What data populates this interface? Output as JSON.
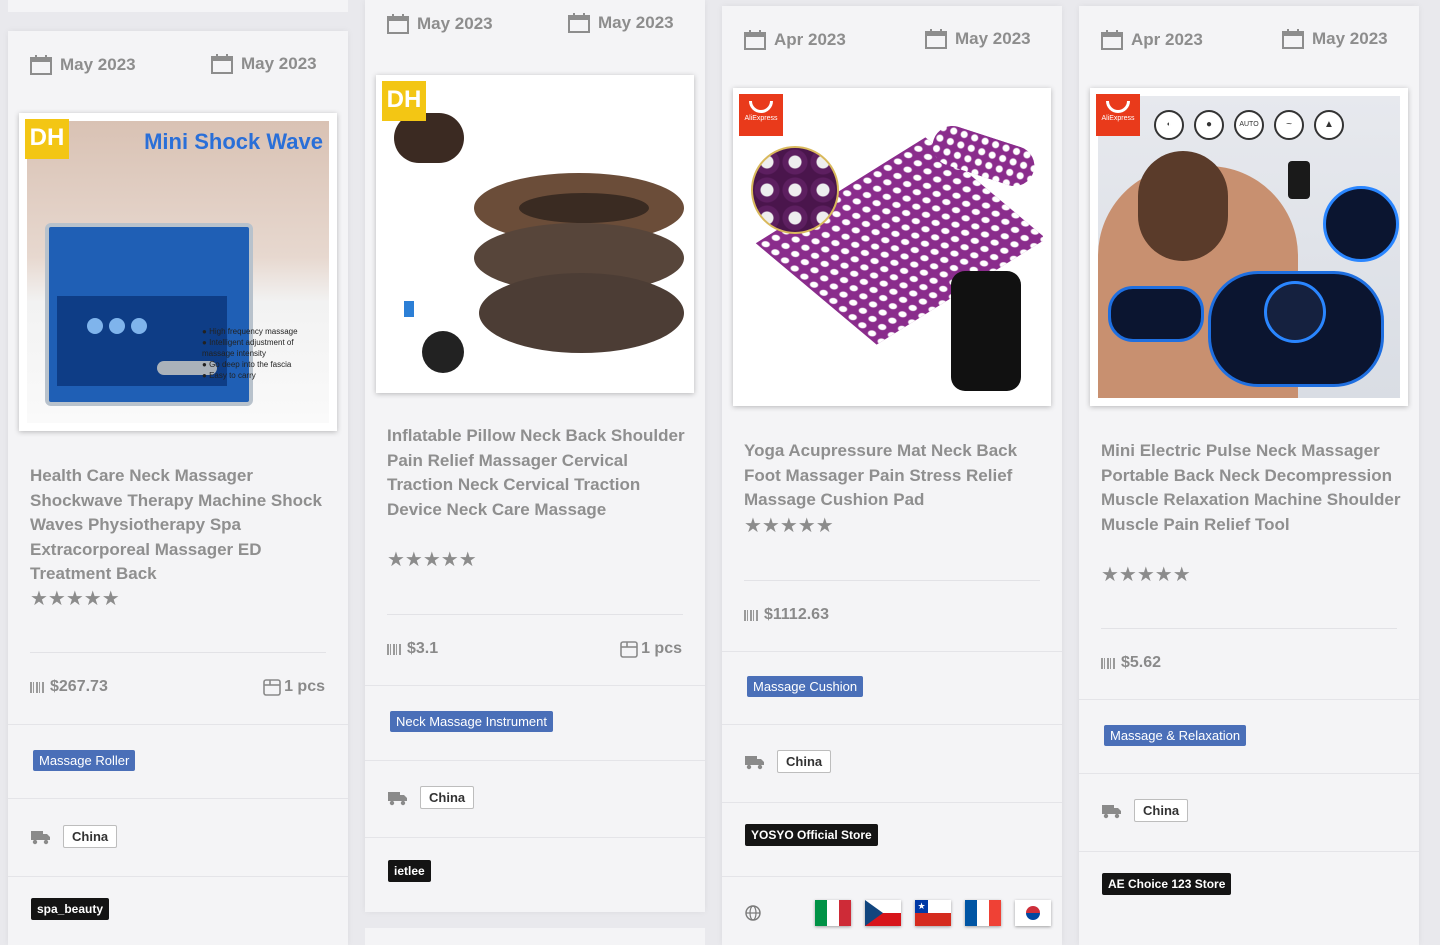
{
  "cards": [
    {
      "date_from": "May 2023",
      "date_to": "May 2023",
      "image_brand": "DH",
      "banner_text": "Mini Shock Wave",
      "features": [
        "High frequency massage",
        "Intelligent adjustment of massage intensity",
        "Go deep into the fascia",
        "Easy to carry"
      ],
      "title": "Health Care Neck Massager Shockwave Therapy Machine Shock Waves Physiotherapy Spa Extracorporeal Massager ED Treatment Back",
      "rating": 5,
      "stars": "★★★★★",
      "price": "$267.73",
      "quantity": "1 pcs",
      "category": "Massage Roller",
      "ships_from": "China",
      "store": "spa_beauty"
    },
    {
      "date_from": "May 2023",
      "date_to": "May 2023",
      "image_brand": "DH",
      "title": "Inflatable Pillow Neck Back Shoulder Pain Relief Massager Cervical Traction Neck Cervical Traction Device Neck Care Massage",
      "rating": 5,
      "stars": "★★★★★",
      "price": "$3.1",
      "quantity": "1 pcs",
      "category": "Neck Massage Instrument",
      "ships_from": "China",
      "store": "ietlee"
    },
    {
      "date_from": "Apr 2023",
      "date_to": "May 2023",
      "image_brand": "AliExpress",
      "title": "Yoga Acupressure Mat Neck Back Foot Massager Pain Stress Relief Massage Cushion Pad",
      "rating": 5,
      "stars": "★★★★★",
      "price": "$1112.63",
      "category": "Massage Cushion",
      "ships_from": "China",
      "store": "YOSYO Official Store",
      "flags": [
        "Italy",
        "Czech Republic",
        "Chile",
        "France",
        "South Korea"
      ]
    },
    {
      "date_from": "Apr 2023",
      "date_to": "May 2023",
      "image_brand": "AliExpress",
      "mode_icons": [
        "mode-1",
        "mode-2",
        "AUTO",
        "mode-4",
        "mode-5"
      ],
      "title": "Mini Electric Pulse Neck Massager Portable Back Neck Decompression Muscle Relaxation Machine Shoulder Muscle Pain Relief Tool",
      "rating": 5,
      "stars": "★★★★★",
      "price": "$5.62",
      "category": "Massage & Relaxation",
      "ships_from": "China",
      "store": "AE Choice 123 Store"
    }
  ],
  "colors": {
    "tag": "#4a6fb8",
    "store": "#141414",
    "card": "#f4f4f6",
    "background": "#e9e9ed"
  }
}
